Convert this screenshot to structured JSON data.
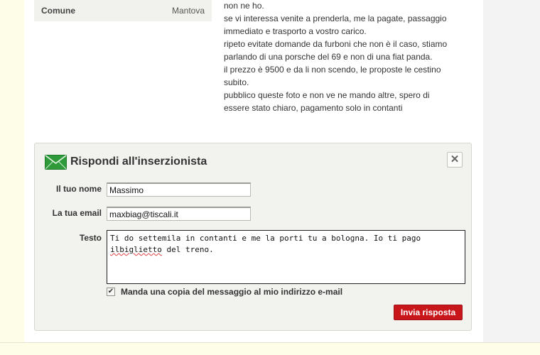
{
  "listing": {
    "attribute": {
      "key": "Comune",
      "value": "Mantova"
    },
    "description_lines": [
      "non ne ho.",
      "se vi interessa venite a prenderla, me la pagate, passaggio",
      "immediato e trasporto a vostro carico.",
      "ripeto evitate domande da furboni che non è il caso, stiamo",
      "parlando di una porsche del 69 e non di una fiat panda.",
      "il prezzo è 9500 e da li non scendo, le proposte le cestino",
      "subito.",
      "pubblico queste foto e non ve ne mando altre, spero di",
      "essere stato chiaro, pagamento solo in contanti"
    ]
  },
  "reply": {
    "title": "Rispondi all'inserzionista",
    "close_symbol": "✕",
    "name_label": "Il tuo nome",
    "name_value": "Massimo",
    "email_label": "La tua email",
    "email_value": "maxbiag@tiscali.it",
    "text_label": "Testo",
    "text_part1": "Ti do settemila in contanti e me la porti tu a bologna. Io ti pago ",
    "text_misspelled": "ilbiglietto",
    "text_part2": " del treno.",
    "copy_label": "Manda una copia del messaggio al mio indirizzo e-mail",
    "copy_checked": true,
    "submit_label": "Invia risposta",
    "icons": {
      "title": "envelope-icon",
      "close": "close-icon",
      "check": "checkmark-icon"
    }
  },
  "colors": {
    "background": "#fdfde8",
    "submit": "#c8161b",
    "envelope": "#2e9a3a"
  }
}
